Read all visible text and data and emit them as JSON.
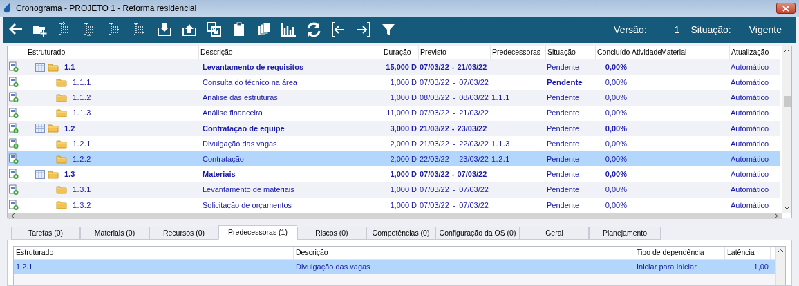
{
  "window": {
    "title": "Cronograma - PROJETO 1 - Reforma residencial"
  },
  "toolbar": {
    "version_label": "Versão:",
    "version": "1",
    "status_label": "Situação:",
    "status": "Vigente"
  },
  "schedule": {
    "columns": [
      "Estruturado",
      "Descrição",
      "Duração",
      "Previsto",
      "Predecessoras",
      "Situação",
      "Concluído",
      "Atividade",
      "Material",
      "Atualização"
    ],
    "rows": [
      {
        "kind": "group",
        "code": "1.1",
        "description": "Levantamento de requisitos",
        "duration": "15,000 D",
        "start": "07/03/22",
        "range_separator": "-",
        "end": "21/03/22",
        "status": "Pendente",
        "status_bold": false,
        "done": "0,00%",
        "update": "Automático",
        "selected": false,
        "children": [
          {
            "kind": "task",
            "code": "1.1.1",
            "description": "Consulta do técnico na área",
            "duration": "1,000 D",
            "start": "07/03/22",
            "range_separator": "-",
            "end": "07/03/22",
            "status": "Pendente",
            "status_bold": true,
            "done": "0,00%",
            "update": "Automático",
            "selected": false
          },
          {
            "kind": "task",
            "code": "1.1.2",
            "description": "Análise das estruturas",
            "duration": "1,000 D",
            "start": "08/03/22",
            "range_separator": "-",
            "end": "08/03/22",
            "predecessors": "1.1.1",
            "status": "Pendente",
            "status_bold": false,
            "done": "0,00%",
            "update": "Automático",
            "selected": false
          },
          {
            "kind": "task",
            "code": "1.1.3",
            "description": "Análise financeira",
            "duration": "11,000 D",
            "start": "07/03/22",
            "range_separator": "-",
            "end": "21/03/22",
            "status": "Pendente",
            "status_bold": false,
            "done": "0,00%",
            "update": "Automático",
            "selected": false
          }
        ]
      },
      {
        "kind": "group",
        "code": "1.2",
        "description": "Contratação de equipe",
        "duration": "3,000 D",
        "start": "21/03/22",
        "range_separator": "-",
        "end": "23/03/22",
        "status": "Pendente",
        "status_bold": false,
        "done": "0,00%",
        "update": "Automático",
        "selected": false,
        "children": [
          {
            "kind": "task",
            "code": "1.2.1",
            "description": "Divulgação das vagas",
            "duration": "2,000 D",
            "start": "21/03/22",
            "range_separator": "-",
            "end": "22/03/22",
            "predecessors": "1.1.3",
            "status": "Pendente",
            "status_bold": false,
            "done": "0,00%",
            "update": "Automático",
            "selected": false
          },
          {
            "kind": "task",
            "code": "1.2.2",
            "description": "Contratação",
            "duration": "2,000 D",
            "start": "22/03/22",
            "range_separator": "-",
            "end": "23/03/22",
            "predecessors": "1.2.1",
            "status": "Pendente",
            "status_bold": false,
            "done": "0,00%",
            "update": "Automático",
            "selected": true
          }
        ]
      },
      {
        "kind": "group",
        "code": "1.3",
        "description": "Materiais",
        "duration": "1,000 D",
        "start": "07/03/22",
        "range_separator": "-",
        "end": "07/03/22",
        "status": "Pendente",
        "status_bold": false,
        "done": "0,00%",
        "update": "Automático",
        "selected": false,
        "children": [
          {
            "kind": "task",
            "code": "1.3.1",
            "description": "Levantamento de materiais",
            "duration": "1,000 D",
            "start": "07/03/22",
            "range_separator": "-",
            "end": "07/03/22",
            "status": "Pendente",
            "status_bold": false,
            "done": "0,00%",
            "update": "Automático",
            "selected": false
          },
          {
            "kind": "task",
            "code": "1.3.2",
            "description": "Solicitação de orçamentos",
            "duration": "1,000 D",
            "start": "07/03/22",
            "range_separator": "-",
            "end": "07/03/22",
            "status": "Pendente",
            "status_bold": false,
            "done": "0,00%",
            "update": "Automático",
            "selected": false
          }
        ]
      }
    ]
  },
  "tabs": [
    {
      "label": "Tarefas (0)",
      "selected": false
    },
    {
      "label": "Materiais (0)",
      "selected": false
    },
    {
      "label": "Recursos (0)",
      "selected": false
    },
    {
      "label": "Predecessoras (1)",
      "selected": true
    },
    {
      "label": "Riscos (0)",
      "selected": false
    },
    {
      "label": "Competências (0)",
      "selected": false
    },
    {
      "label": "Configuração da OS (0)",
      "selected": false
    },
    {
      "label": "Geral",
      "selected": false
    },
    {
      "label": "Planejamento",
      "selected": false
    }
  ],
  "predecessors_table": {
    "columns": [
      "Estruturado",
      "Descrição",
      "Tipo de dependência",
      "Latência"
    ],
    "rows": [
      {
        "code": "1.2.1",
        "description": "Divulgação das vagas",
        "type": "Iniciar para Iniciar",
        "latency": "1,00",
        "selected": true
      }
    ]
  }
}
